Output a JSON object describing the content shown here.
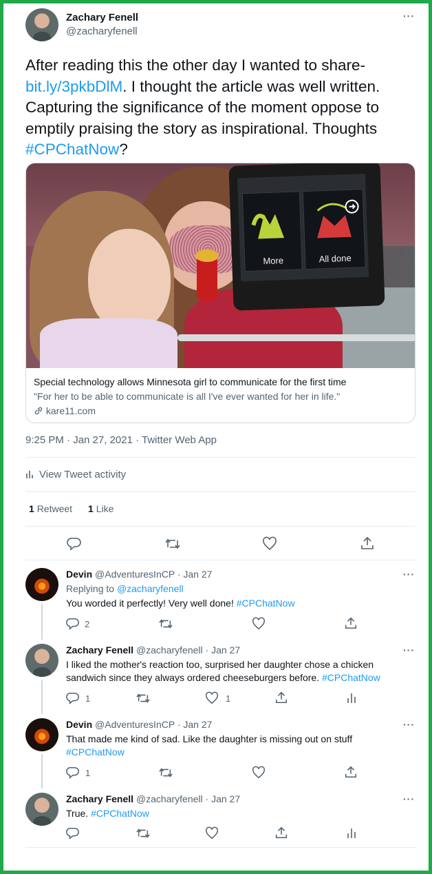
{
  "main_tweet": {
    "author_name": "Zachary Fenell",
    "author_handle": "@zacharyfenell",
    "text_line1": "After reading this the other day I wanted to share-",
    "link": "bit.ly/3pkbDlM",
    "text_after_link": ". I thought the article was well written.",
    "text_line3": "Capturing the significance of the moment oppose to",
    "text_line4": "emptily praising the story as inspirational. Thoughts",
    "hashtag": "#CPChatNow",
    "text_end": "?",
    "card": {
      "image_labels": [
        "More",
        "All done"
      ],
      "title": "Special technology allows Minnesota girl to communicate for the first time",
      "description": "\"For her to be able to communicate is all I've ever wanted for her in life.\"",
      "domain": "kare11.com"
    },
    "timestamp": "9:25 PM · Jan 27, 2021 · Twitter Web App",
    "activity_label": "View Tweet activity",
    "retweet_count": "1",
    "retweet_label": "Retweet",
    "like_count": "1",
    "like_label": "Like"
  },
  "replies": [
    {
      "name": "Devin",
      "handle": "@AdventuresInCP",
      "date": "· Jan 27",
      "replying_prefix": "Replying to",
      "replying_to": "@zacharyfenell",
      "text": "You worded it perfectly! Very well done!",
      "hashtag": "#CPChatNow",
      "reply_count": "2",
      "like_count": ""
    },
    {
      "name": "Zachary Fenell",
      "handle": "@zacharyfenell",
      "date": "· Jan 27",
      "line1": "I liked the mother's reaction too, surprised her daughter chose a chicken",
      "line2": "sandwich since they always ordered cheeseburgers before.",
      "hashtag": "#CPChatNow",
      "reply_count": "1",
      "like_count": "1"
    },
    {
      "name": "Devin",
      "handle": "@AdventuresInCP",
      "date": "· Jan 27",
      "line1": "That made me kind of sad. Like the daughter is missing out on stuff",
      "hashtag": "#CPChatNow",
      "reply_count": "1"
    },
    {
      "name": "Zachary Fenell",
      "handle": "@zacharyfenell",
      "date": "· Jan 27",
      "text": "True.",
      "hashtag": "#CPChatNow"
    }
  ],
  "colors": {
    "frame": "#21a84a",
    "link": "#1d9bf0",
    "muted": "#536471",
    "divider": "#e6ecf0"
  },
  "icons": [
    "more-icon",
    "link-icon",
    "activity-icon",
    "reply-icon",
    "retweet-icon",
    "like-icon",
    "share-icon",
    "analytics-icon"
  ]
}
